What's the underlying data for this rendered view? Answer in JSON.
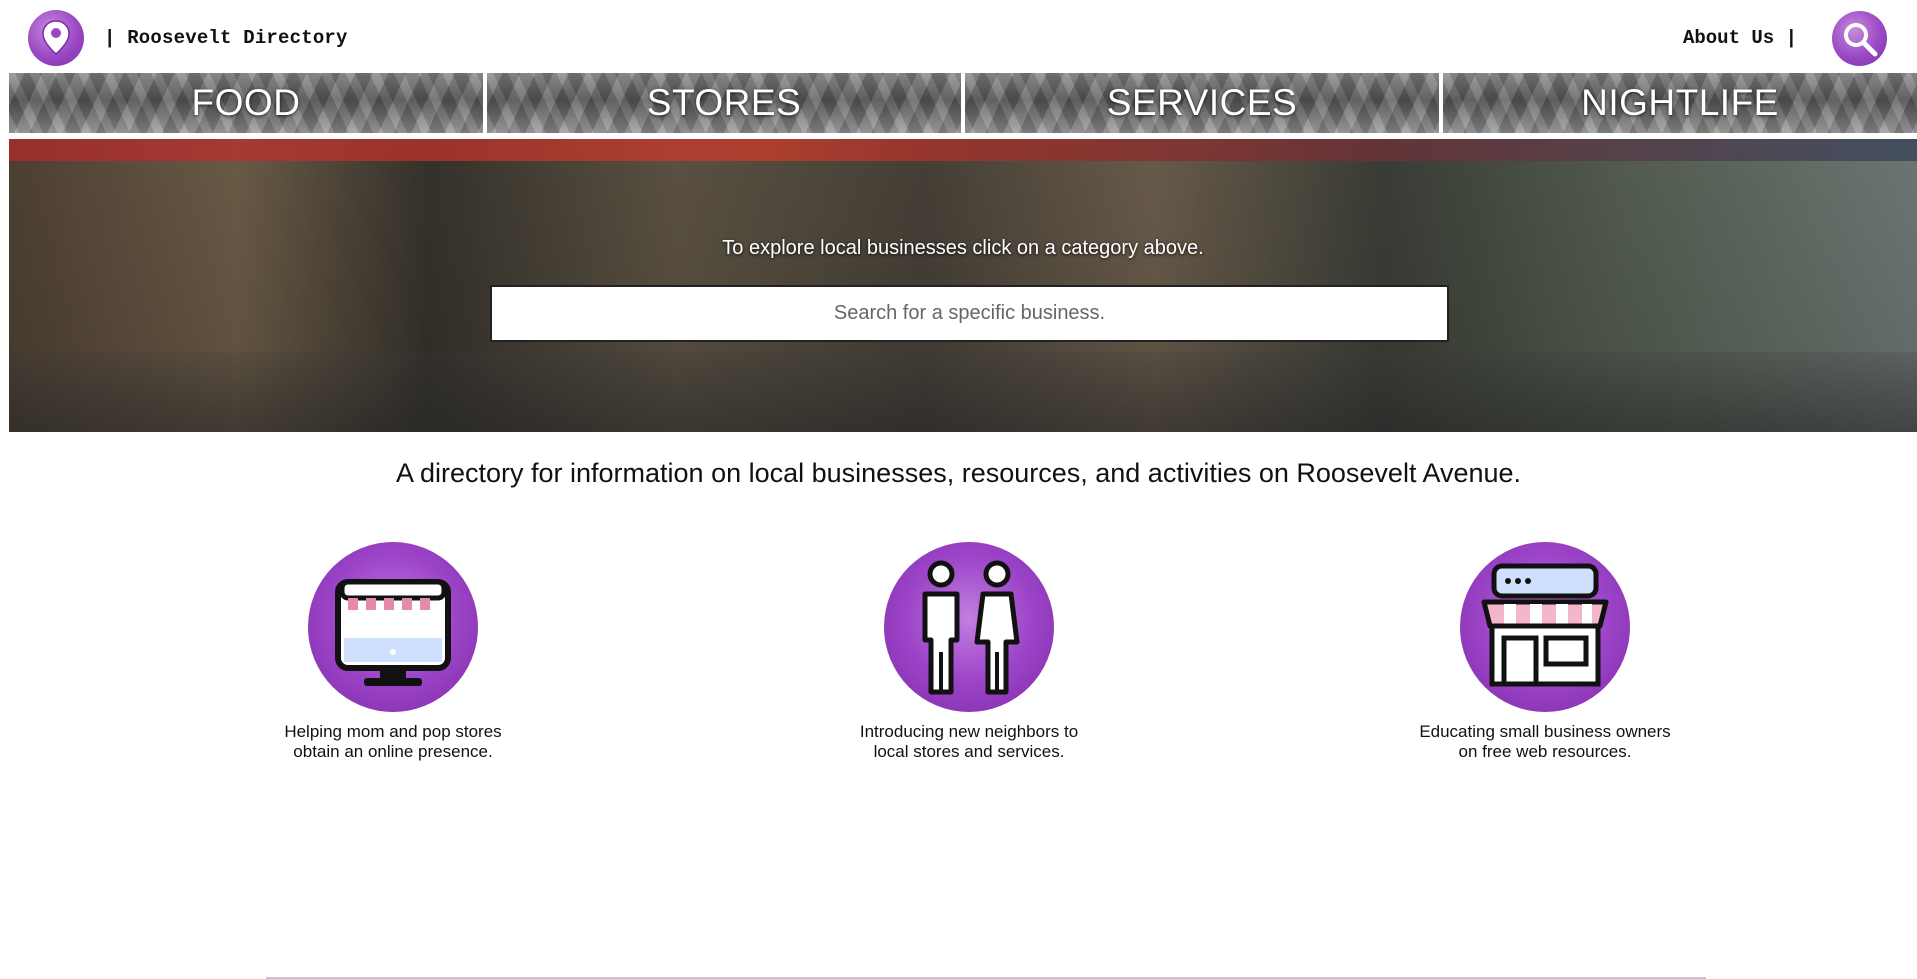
{
  "header": {
    "logo_icon": "map-pin-icon",
    "brand": "| Roosevelt Directory",
    "about_label": "About Us |",
    "search_icon": "search-icon",
    "accent_color": "#9b48c4"
  },
  "categories": [
    {
      "label": "FOOD"
    },
    {
      "label": "STORES"
    },
    {
      "label": "SERVICES"
    },
    {
      "label": "NIGHTLIFE"
    }
  ],
  "hero": {
    "prompt": "To explore local businesses click on a category above.",
    "search_placeholder": "Search for a specific business."
  },
  "tagline": "A directory for information on local businesses, resources, and activities on Roosevelt Avenue.",
  "features": [
    {
      "icon": "storefront-monitor-icon",
      "line1": "Helping mom and pop stores",
      "line2": "obtain an online presence."
    },
    {
      "icon": "people-icon",
      "line1": "Introducing new neighbors to",
      "line2": "local stores and services."
    },
    {
      "icon": "shop-icon",
      "line1": "Educating small business owners",
      "line2": "on free web resources."
    }
  ]
}
